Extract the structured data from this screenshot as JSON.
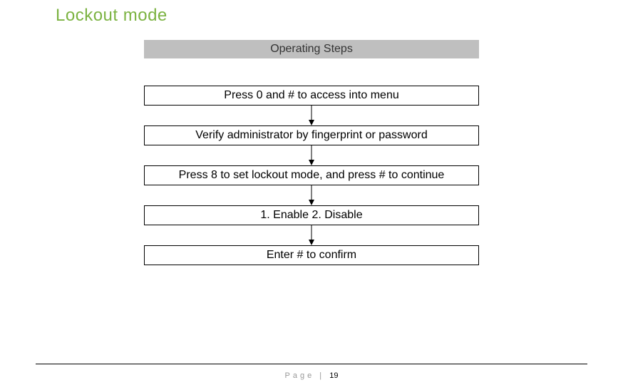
{
  "heading": "Lockout mode",
  "header_label": "Operating Steps",
  "steps": {
    "s1": "Press  0  and  #  to access into menu",
    "s2": "Verify administrator by fingerprint or password",
    "s3": "Press 8 to set lockout mode, and press # to continue",
    "s4": "1. Enable 2. Disable",
    "s5": "Enter # to confirm"
  },
  "footer": {
    "label": "Page",
    "separator": " | ",
    "number": "19"
  }
}
